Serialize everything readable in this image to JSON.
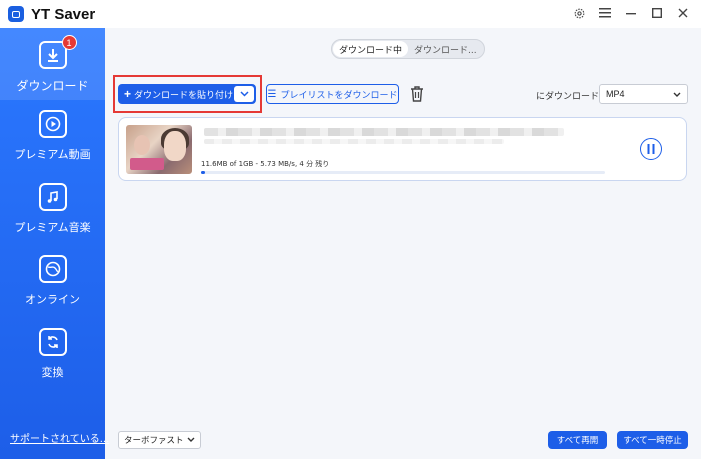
{
  "app": {
    "title": "YT Saver"
  },
  "window_controls": [
    "gear-icon",
    "menu-icon",
    "minimize-icon",
    "maximize-icon",
    "close-icon"
  ],
  "sidebar": {
    "items": [
      {
        "label": "ダウンロード",
        "icon": "download-icon",
        "active": true,
        "badge": "1"
      },
      {
        "label": "プレミアム動画",
        "icon": "play-icon",
        "active": false
      },
      {
        "label": "プレミアム音楽",
        "icon": "music-icon",
        "active": false
      },
      {
        "label": "オンライン",
        "icon": "globe-icon",
        "active": false
      },
      {
        "label": "変換",
        "icon": "convert-icon",
        "active": false
      }
    ],
    "support_link": "サポートされている..."
  },
  "tabs": [
    {
      "label": "ダウンロード中",
      "active": true
    },
    {
      "label": "ダウンロード...",
      "active": false
    }
  ],
  "toolbar": {
    "paste_label": "ダウンロードを貼り付け",
    "playlist_label": "プレイリストをダウンロード",
    "format_prefix": "にダウンロード",
    "format_value": "MP4"
  },
  "download": {
    "progress_text": "11.6MB of 1GB - 5.73 MB/s, 4 分 残り",
    "progress_fraction": 0.011
  },
  "footer": {
    "speed_mode": "ターボファスト",
    "resume_all": "すべて再開",
    "pause_all": "すべて一時停止"
  },
  "colors": {
    "accent": "#1d5ee8",
    "highlight": "#e53935"
  }
}
